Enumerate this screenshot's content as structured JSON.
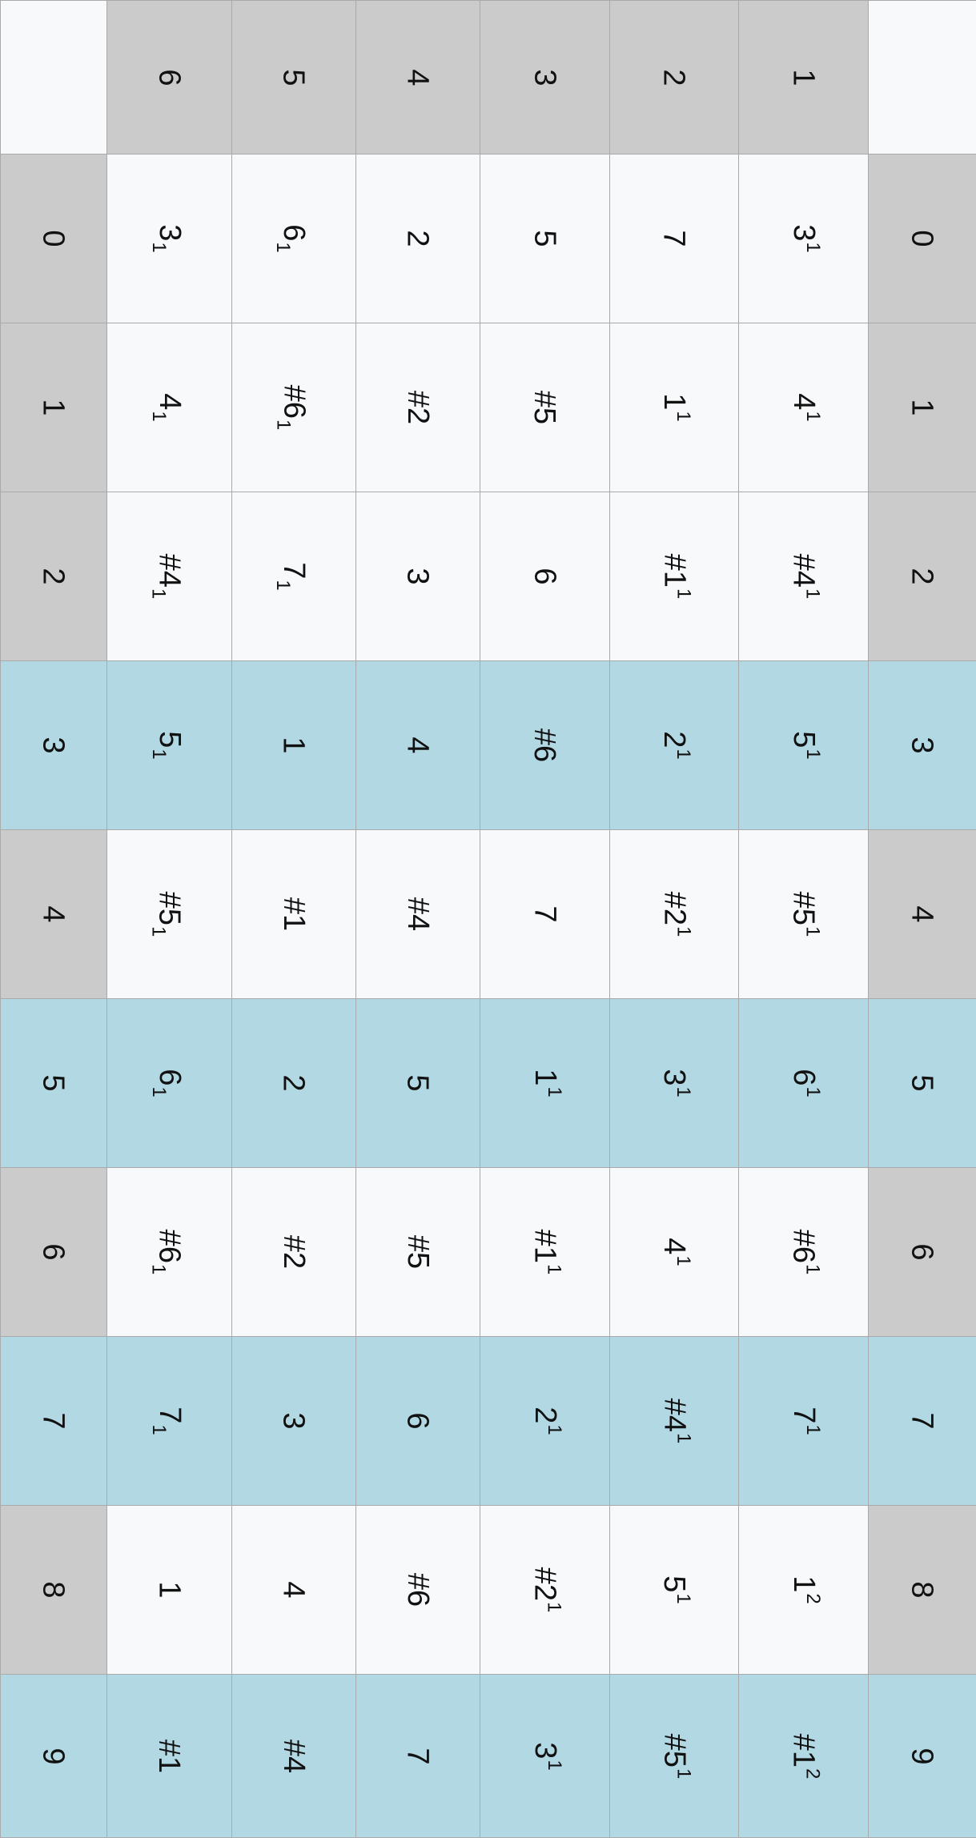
{
  "header_row": [
    "",
    "6",
    "5",
    "4",
    "3",
    "2",
    "1",
    ""
  ],
  "colors": {
    "header_bg": "#cbcbcb",
    "cell_bg": "#f8f9fa",
    "highlight_bg": "#b2d8e4",
    "border": "#a9aaab",
    "text": "#111111"
  },
  "rows": [
    {
      "label": "0",
      "highlight": false,
      "cells": [
        {
          "t": "3",
          "sub": "1"
        },
        {
          "t": "6",
          "sub": "1"
        },
        {
          "t": "2"
        },
        {
          "t": "5"
        },
        {
          "t": "7"
        },
        {
          "t": "3",
          "sup": "1"
        }
      ]
    },
    {
      "label": "1",
      "highlight": false,
      "cells": [
        {
          "t": "4",
          "sub": "1"
        },
        {
          "t": "#6",
          "sub": "1"
        },
        {
          "t": "#2"
        },
        {
          "t": "#5"
        },
        {
          "t": "1",
          "sup": "1"
        },
        {
          "t": "4",
          "sup": "1"
        }
      ]
    },
    {
      "label": "2",
      "highlight": false,
      "cells": [
        {
          "t": "#4",
          "sub": "1"
        },
        {
          "t": "7",
          "sub": "1"
        },
        {
          "t": "3"
        },
        {
          "t": "6"
        },
        {
          "t": "#1",
          "sup": "1"
        },
        {
          "t": "#4",
          "sup": "1"
        }
      ]
    },
    {
      "label": "3",
      "highlight": true,
      "cells": [
        {
          "t": "5",
          "sub": "1"
        },
        {
          "t": "1"
        },
        {
          "t": "4"
        },
        {
          "t": "#6"
        },
        {
          "t": "2",
          "sup": "1"
        },
        {
          "t": "5",
          "sup": "1"
        }
      ]
    },
    {
      "label": "4",
      "highlight": false,
      "cells": [
        {
          "t": "#5",
          "sub": "1"
        },
        {
          "t": "#1"
        },
        {
          "t": "#4"
        },
        {
          "t": "7"
        },
        {
          "t": "#2",
          "sup": "1"
        },
        {
          "t": "#5",
          "sup": "1"
        }
      ]
    },
    {
      "label": "5",
      "highlight": true,
      "cells": [
        {
          "t": "6",
          "sub": "1"
        },
        {
          "t": "2"
        },
        {
          "t": "5"
        },
        {
          "t": "1",
          "sup": "1"
        },
        {
          "t": "3",
          "sup": "1"
        },
        {
          "t": "6",
          "sup": "1"
        }
      ]
    },
    {
      "label": "6",
      "highlight": false,
      "cells": [
        {
          "t": "#6",
          "sub": "1"
        },
        {
          "t": "#2"
        },
        {
          "t": "#5"
        },
        {
          "t": "#1",
          "sup": "1"
        },
        {
          "t": "4",
          "sup": "1"
        },
        {
          "t": "#6",
          "sup": "1"
        }
      ]
    },
    {
      "label": "7",
      "highlight": true,
      "cells": [
        {
          "t": "7",
          "sub": "1"
        },
        {
          "t": "3"
        },
        {
          "t": "6"
        },
        {
          "t": "2",
          "sup": "1"
        },
        {
          "t": "#4",
          "sup": "1"
        },
        {
          "t": "7",
          "sup": "1"
        }
      ]
    },
    {
      "label": "8",
      "highlight": false,
      "cells": [
        {
          "t": "1"
        },
        {
          "t": "4"
        },
        {
          "t": "#6"
        },
        {
          "t": "#2",
          "sup": "1"
        },
        {
          "t": "5",
          "sup": "1"
        },
        {
          "t": "1",
          "sup": "2"
        }
      ]
    },
    {
      "label": "9",
      "highlight": true,
      "cells": [
        {
          "t": "#1"
        },
        {
          "t": "#4"
        },
        {
          "t": "7"
        },
        {
          "t": "3",
          "sup": "1"
        },
        {
          "t": "#5",
          "sup": "1"
        },
        {
          "t": "#1",
          "sup": "2"
        }
      ]
    }
  ]
}
